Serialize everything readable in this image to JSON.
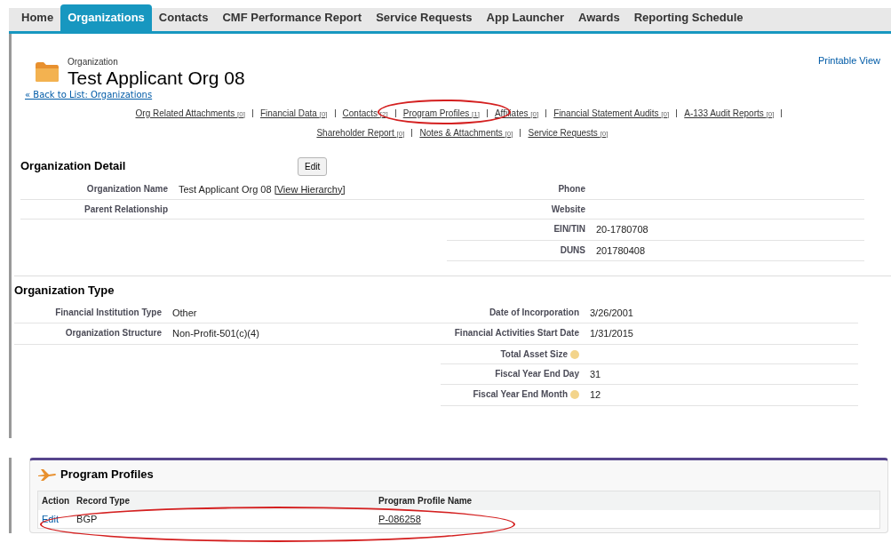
{
  "tabs": [
    {
      "label": "Home",
      "selected": false
    },
    {
      "label": "Organizations",
      "selected": true
    },
    {
      "label": "Contacts",
      "selected": false
    },
    {
      "label": "CMF Performance Report",
      "selected": false
    },
    {
      "label": "Service Requests",
      "selected": false
    },
    {
      "label": "App Launcher",
      "selected": false
    },
    {
      "label": "Awards",
      "selected": false
    },
    {
      "label": "Reporting Schedule",
      "selected": false
    }
  ],
  "header": {
    "object_type": "Organization",
    "title": "Test Applicant Org 08",
    "back_link": "« Back to List: Organizations",
    "printable_view": "Printable View"
  },
  "related_link_lines": [
    [
      {
        "label": "Org Related Attachments",
        "count": "[0]"
      },
      {
        "label": "Financial Data",
        "count": "[0]"
      },
      {
        "label": "Contacts",
        "count": "[2]"
      },
      {
        "label": "Program Profiles",
        "count": "[1]"
      },
      {
        "label": "Affiliates",
        "count": "[0]"
      },
      {
        "label": "Financial Statement Audits",
        "count": "[0]"
      },
      {
        "label": "A-133 Audit Reports",
        "count": "[0]"
      }
    ],
    [
      {
        "label": "Shareholder Report",
        "count": "[0]"
      },
      {
        "label": "Notes & Attachments",
        "count": "[0]"
      },
      {
        "label": "Service Requests",
        "count": "[0]"
      }
    ]
  ],
  "detail": {
    "title": "Organization Detail",
    "edit_button": "Edit",
    "rows": [
      {
        "left": {
          "label": "Organization Name",
          "value": "Test Applicant Org 08",
          "link": "[View Hierarchy]"
        },
        "right": {
          "label": "Phone"
        }
      },
      {
        "left": {
          "label": "Parent Relationship"
        },
        "right": {
          "label": "Website"
        }
      },
      {
        "right": {
          "label": "EIN/TIN",
          "value": "20-1780708"
        }
      },
      {
        "right": {
          "label": "DUNS",
          "value": "201780408"
        }
      }
    ]
  },
  "org_type": {
    "title": "Organization Type",
    "rows": [
      {
        "left": {
          "label": "Financial Institution Type",
          "value": "Other"
        },
        "right": {
          "label": "Date of Incorporation",
          "value": "3/26/2001"
        }
      },
      {
        "left": {
          "label": "Organization Structure",
          "value": "Non-Profit-501(c)(4)"
        },
        "right": {
          "label": "Financial Activities Start Date",
          "value": "1/31/2015"
        }
      },
      {
        "right": {
          "label": "Total Asset Size",
          "help": true
        }
      },
      {
        "right": {
          "label": "Fiscal Year End Day",
          "value": "31"
        }
      },
      {
        "right": {
          "label": "Fiscal Year End Month",
          "value": "12",
          "help": true
        }
      }
    ]
  },
  "program_profiles": {
    "title": "Program Profiles",
    "columns": [
      "Action",
      "Record Type",
      "Program Profile Name"
    ],
    "rows": [
      {
        "action": "Edit",
        "record_type": "BGP",
        "name": "P-086258"
      }
    ]
  }
}
